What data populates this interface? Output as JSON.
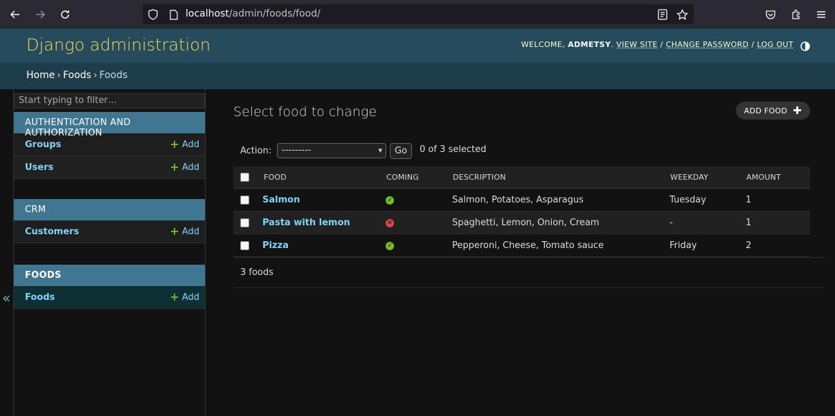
{
  "browser": {
    "url_host": "localhost",
    "url_path": "/admin/foods/food/"
  },
  "header": {
    "branding": "Django administration",
    "welcome": "WELCOME,",
    "username": "ADMETSY",
    "view_site": "VIEW SITE",
    "change_password": "CHANGE PASSWORD",
    "log_out": "LOG OUT",
    "sep": "/"
  },
  "breadcrumbs": {
    "home": "Home",
    "app": "Foods",
    "model": "Foods",
    "sep": "›"
  },
  "sidebar": {
    "toggle": "«",
    "filter_placeholder": "Start typing to filter…",
    "modules": [
      {
        "caption": "Authentication and Authorization",
        "rows": [
          {
            "label": "Groups",
            "add": "Add"
          },
          {
            "label": "Users",
            "add": "Add"
          }
        ]
      },
      {
        "caption": "CRM",
        "rows": [
          {
            "label": "Customers",
            "add": "Add"
          }
        ]
      },
      {
        "caption": "Foods",
        "rows": [
          {
            "label": "Foods",
            "add": "Add"
          }
        ]
      }
    ]
  },
  "content": {
    "title": "Select food to change",
    "add_button": "ADD FOOD",
    "action_label": "Action:",
    "action_value": "---------",
    "go": "Go",
    "selected": "0 of 3 selected",
    "columns": [
      "FOOD",
      "COMING",
      "DESCRIPTION",
      "WEEKDAY",
      "AMOUNT"
    ],
    "rows": [
      {
        "food": "Salmon",
        "coming": true,
        "description": "Salmon, Potatoes, Asparagus",
        "weekday": "Tuesday",
        "amount": "1"
      },
      {
        "food": "Pasta with lemon",
        "coming": false,
        "description": "Spaghetti, Lemon, Onion, Cream",
        "weekday": "-",
        "amount": "1"
      },
      {
        "food": "Pizza",
        "coming": true,
        "description": "Pepperoni, Cheese, Tomato sauce",
        "weekday": "Friday",
        "amount": "2"
      }
    ],
    "count": "3 foods"
  },
  "colors": {
    "header_bg": "#264b5d",
    "branding": "#f5dd5d",
    "breadcrumb_bg": "#1f3c4a",
    "module_caption": "#417690",
    "link": "#81d4fa",
    "add_plus": "#70bf2b",
    "status_yes": "#70bf2b",
    "status_no": "#dd4646"
  }
}
